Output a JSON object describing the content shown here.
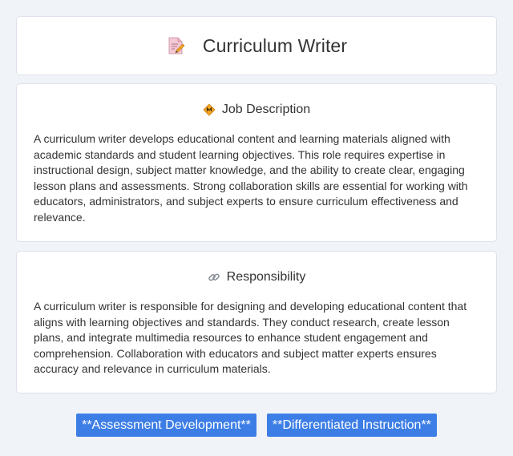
{
  "header": {
    "title": "Curriculum Writer",
    "icon": "memo-pencil-icon"
  },
  "job_description": {
    "heading": "Job Description",
    "icon": "diamond-warning-icon",
    "body": "A curriculum writer develops educational content and learning materials aligned with academic standards and student learning objectives. This role requires expertise in instructional design, subject matter knowledge, and the ability to create clear, engaging lesson plans and assessments. Strong collaboration skills are essential for working with educators, administrators, and subject experts to ensure curriculum effectiveness and relevance."
  },
  "responsibility": {
    "heading": "Responsibility",
    "icon": "link-icon",
    "body": "A curriculum writer is responsible for designing and developing educational content that aligns with learning objectives and standards. They conduct research, create lesson plans, and integrate multimedia resources to enhance student engagement and comprehension. Collaboration with educators and subject matter experts ensures accuracy and relevance in curriculum materials."
  },
  "tags": [
    "**Assessment Development**",
    "**Differentiated Instruction**"
  ],
  "colors": {
    "background": "#f0f3f8",
    "card": "#ffffff",
    "tag": "#3d7ee6"
  }
}
